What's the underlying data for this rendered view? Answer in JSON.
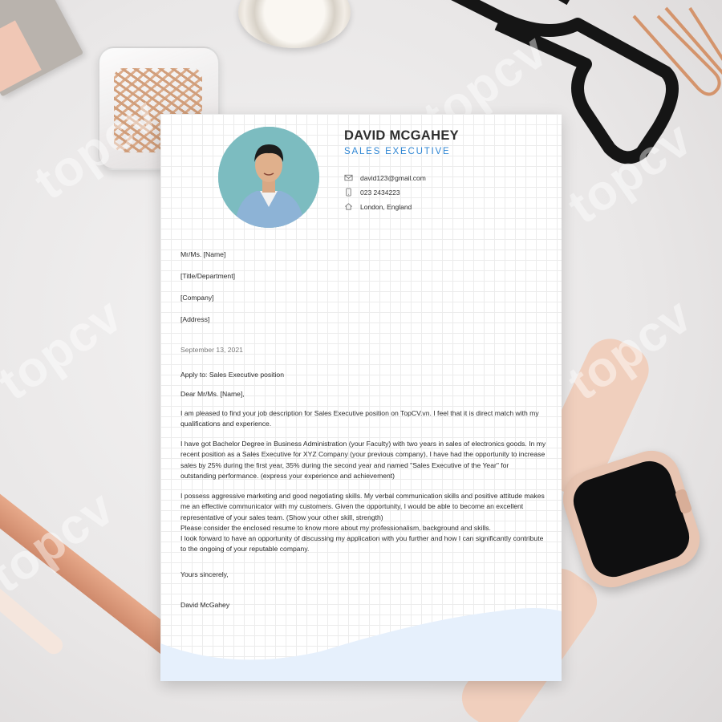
{
  "header": {
    "name": "DAVID MCGAHEY",
    "job_title": "SALES EXECUTIVE",
    "email": "david123@gmail.com",
    "phone": "023 2434223",
    "location": "London, England"
  },
  "recipient": {
    "line1": "Mr/Ms. [Name]",
    "line2": "[Title/Department]",
    "line3": "[Company]",
    "line4": "[Address]"
  },
  "date": "September 13, 2021",
  "subject": "Apply to: Sales Executive position",
  "greeting": "Dear Mr/Ms. [Name],",
  "body": {
    "p1": "I am pleased to find your job description for Sales Executive position on TopCV.vn. I feel that it is direct match with my qualifications and experience.",
    "p2": "I have got Bachelor Degree in Business Administration (your Faculty) with two years in sales of electronics  goods.  In my recent position as a Sales Executive for XYZ Company (your previous company), I have had the opportunity to increase sales by 25% during the first year, 35% during the second year and named \"Sales Executive of the Year\" for outstanding performance. (express your experience and achievement)",
    "p3": "I possess aggressive marketing and good negotiating skills. My verbal communication skills and positive attitude makes me an effective communicator with my customers. Given the opportunity, I would be able to become an excellent representative of your sales team. (Show your other skill, strength)",
    "p4": "Please consider the enclosed resume to know more about my professionalism, background and skills.",
    "p5": "I look forward to have an opportunity of discussing my application with you further and how I can significantly contribute to the ongoing of your reputable company."
  },
  "closing": "Yours sincerely,",
  "signature": "David McGahey",
  "watermark": "topcv",
  "colors": {
    "accent": "#2f86d4",
    "wave": "#e6f0fc",
    "watch_band": "#f0cfbd"
  },
  "icons": [
    "email-icon",
    "phone-icon",
    "home-icon"
  ]
}
